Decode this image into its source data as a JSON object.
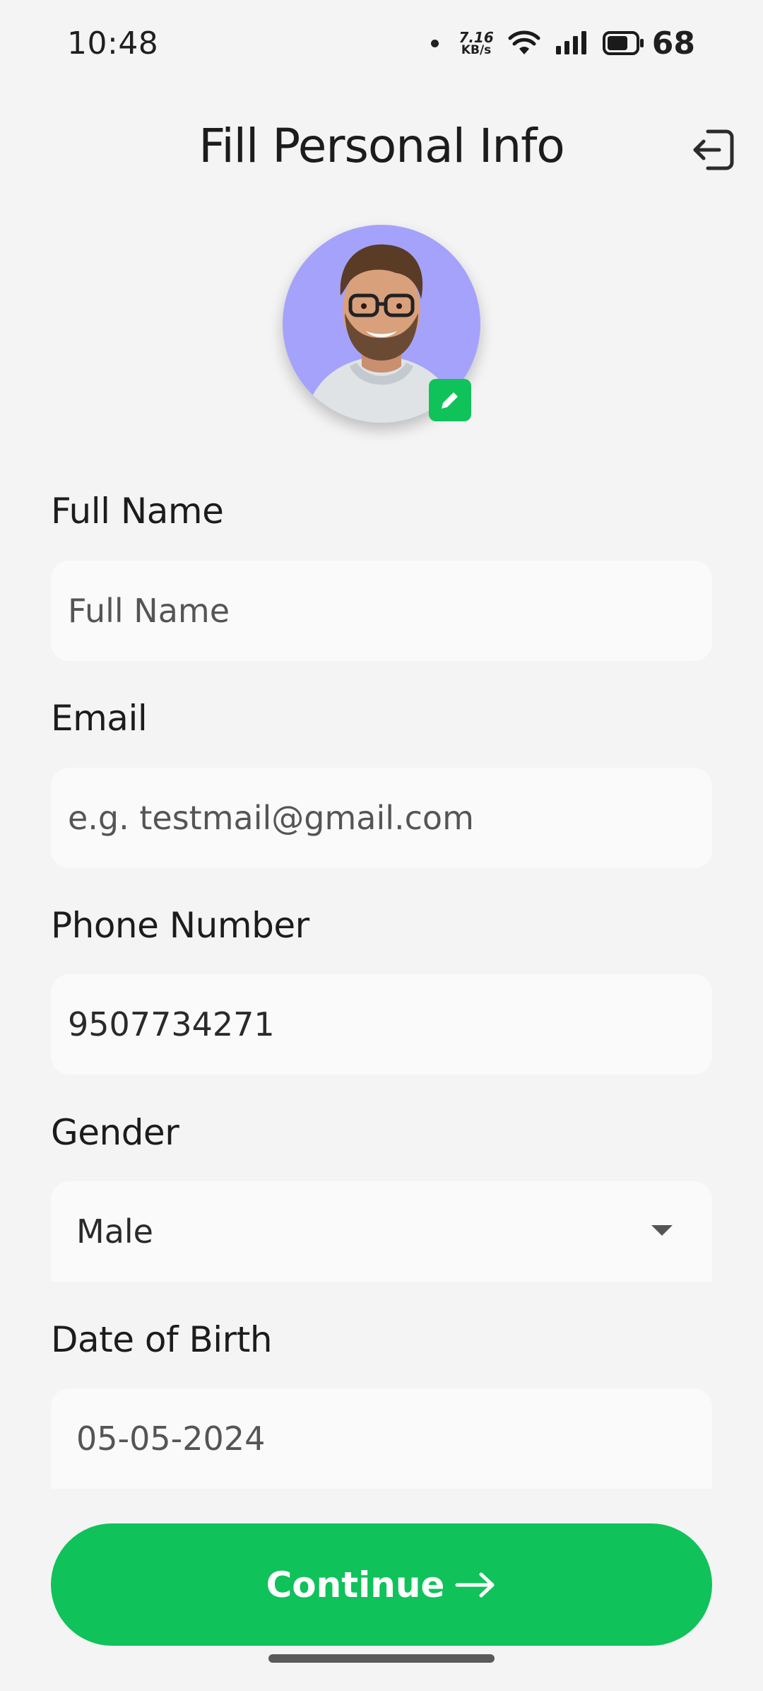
{
  "status_bar": {
    "time": "10:48",
    "net_speed_value": "7.16",
    "net_speed_unit": "KB/s",
    "battery_level": "68",
    "icons": [
      "notification-dot-icon",
      "wifi-icon",
      "signal-icon",
      "battery-icon"
    ]
  },
  "header": {
    "title": "Fill Personal Info",
    "logout_icon": "logout-icon"
  },
  "avatar": {
    "edit_icon": "pencil-icon",
    "bg_color": "#a4a2fb"
  },
  "form": {
    "full_name": {
      "label": "Full Name",
      "placeholder": "Full Name"
    },
    "email": {
      "label": "Email",
      "placeholder": "e.g. testmail@gmail.com"
    },
    "phone": {
      "label": "Phone Number",
      "value": "9507734271"
    },
    "gender": {
      "label": "Gender",
      "value": "Male"
    },
    "dob": {
      "label": "Date of Birth",
      "value": "05-05-2024"
    }
  },
  "continue_button": {
    "label": "Continue",
    "icon": "arrow-right-icon"
  },
  "colors": {
    "accent": "#0fc25a",
    "background": "#f4f4f4",
    "input_bg": "#fafafa"
  }
}
